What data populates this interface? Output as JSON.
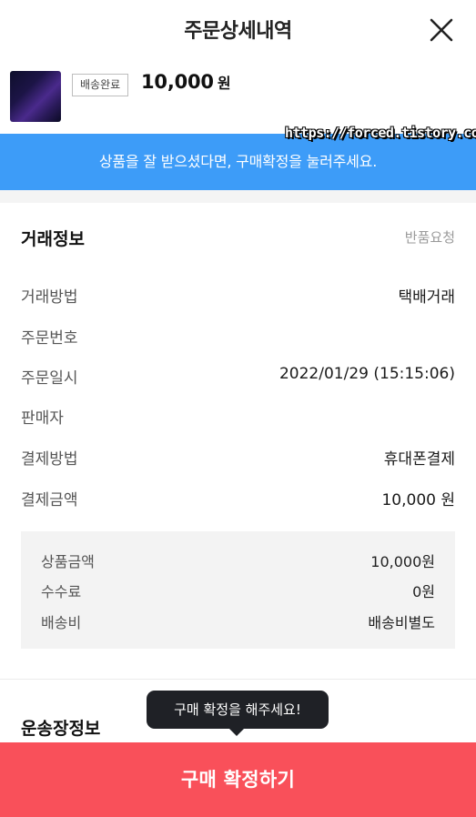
{
  "header": {
    "title": "주문상세내역",
    "close_icon": "close-icon"
  },
  "product": {
    "status_badge": "배송완료",
    "price": "10,000",
    "price_unit": "원"
  },
  "watermark": "https://forced.tistory.com",
  "banner": {
    "text": "상품을 잘 받으셨다면, 구매확정을 눌러주세요.",
    "color": "#3d9cf8"
  },
  "trade_info": {
    "title": "거래정보",
    "return_link": "반품요청",
    "rows": [
      {
        "label": "거래방법",
        "value": "택배거래"
      },
      {
        "label": "주문번호",
        "value": ""
      },
      {
        "label": "주문일시",
        "value": "2022/01/29 (15:15:06)"
      },
      {
        "label": "판매자",
        "value": ""
      },
      {
        "label": "결제방법",
        "value": "휴대폰결제"
      },
      {
        "label": "결제금액",
        "value": "10,000 원"
      }
    ]
  },
  "summary": [
    {
      "label": "상품금액",
      "value": "10,000원"
    },
    {
      "label": "수수료",
      "value": "0원"
    },
    {
      "label": "배송비",
      "value": "배송비별도"
    }
  ],
  "shipping_info": {
    "title": "운송장정보"
  },
  "tooltip": {
    "text": "구매 확정을 해주세요!"
  },
  "confirm_button": {
    "label": "구매 확정하기",
    "color": "#f9505a"
  }
}
